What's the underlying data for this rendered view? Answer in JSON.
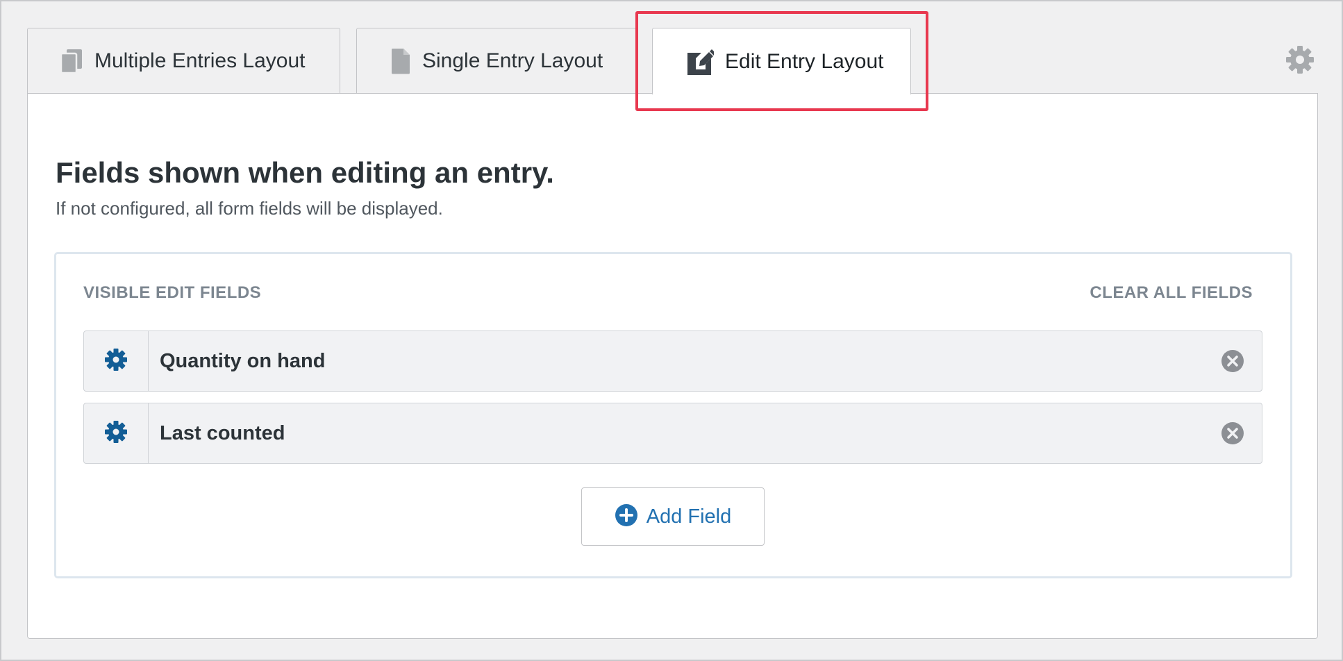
{
  "tabs": [
    {
      "label": "Multiple Entries Layout",
      "icon": "copy-icon",
      "active": false
    },
    {
      "label": "Single Entry Layout",
      "icon": "document-icon",
      "active": false
    },
    {
      "label": "Edit Entry Layout",
      "icon": "edit-icon",
      "active": true
    }
  ],
  "header": {
    "settings_icon": "gear-icon"
  },
  "panel": {
    "title": "Fields shown when editing an entry.",
    "subtitle": "If not configured, all form fields will be displayed."
  },
  "fields_section": {
    "heading": "VISIBLE EDIT FIELDS",
    "clear_all_label": "CLEAR ALL FIELDS",
    "fields": [
      {
        "label": "Quantity on hand",
        "settings_icon": "gear-icon",
        "remove_icon": "remove-icon"
      },
      {
        "label": "Last counted",
        "settings_icon": "gear-icon",
        "remove_icon": "remove-icon"
      }
    ],
    "add_button_label": "Add Field",
    "add_button_icon": "plus-circle-icon"
  },
  "colors": {
    "accent": "#2271b1",
    "gear_blue": "#135e96",
    "highlight": "#e8384f",
    "muted_text": "#7c8690"
  }
}
